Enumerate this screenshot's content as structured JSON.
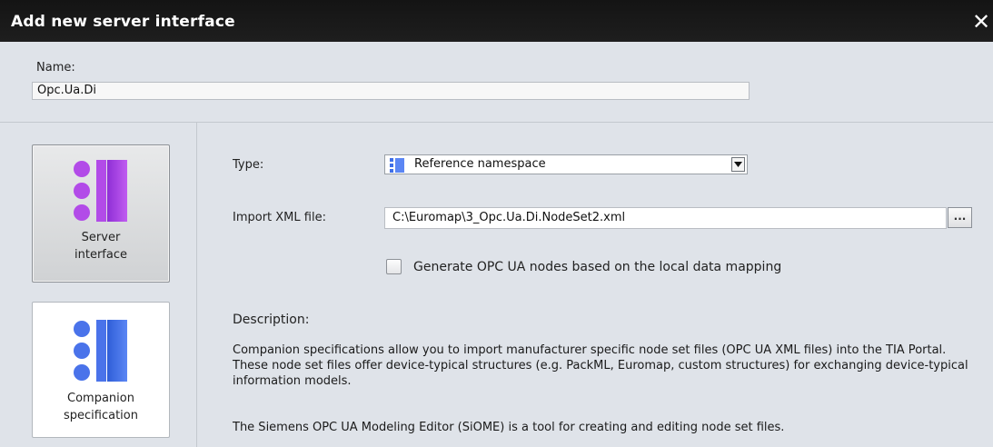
{
  "dialog": {
    "title": "Add new server interface",
    "close_glyph": "✕"
  },
  "name_field": {
    "label": "Name:",
    "value": "Opc.Ua.Di"
  },
  "tiles": [
    {
      "label": "Server\ninterface",
      "icon": "server-interface-icon",
      "color": "#a83fe0",
      "selected": true
    },
    {
      "label": "Companion\nspecification",
      "icon": "companion-specification-icon",
      "color": "#3f6fe8",
      "selected": false
    }
  ],
  "form": {
    "type_label": "Type:",
    "type_value": "Reference namespace",
    "xml_label": "Import XML file:",
    "xml_value": "C:\\Euromap\\3_Opc.Ua.Di.NodeSet2.xml",
    "browse_label": "...",
    "generate_checkbox_label": "Generate OPC UA nodes based on the local data mapping",
    "generate_checked": false
  },
  "description": {
    "heading": "Description:",
    "paragraph1": "Companion specifications allow you to import manufacturer specific node set files (OPC UA XML files) into the TIA Portal. These node set files offer device-typical structures (e.g. PackML, Euromap, custom structures) for exchanging device-typical information models.",
    "paragraph2": "The Siemens OPC UA Modeling Editor (SiOME) is a tool for creating and editing node set files."
  }
}
